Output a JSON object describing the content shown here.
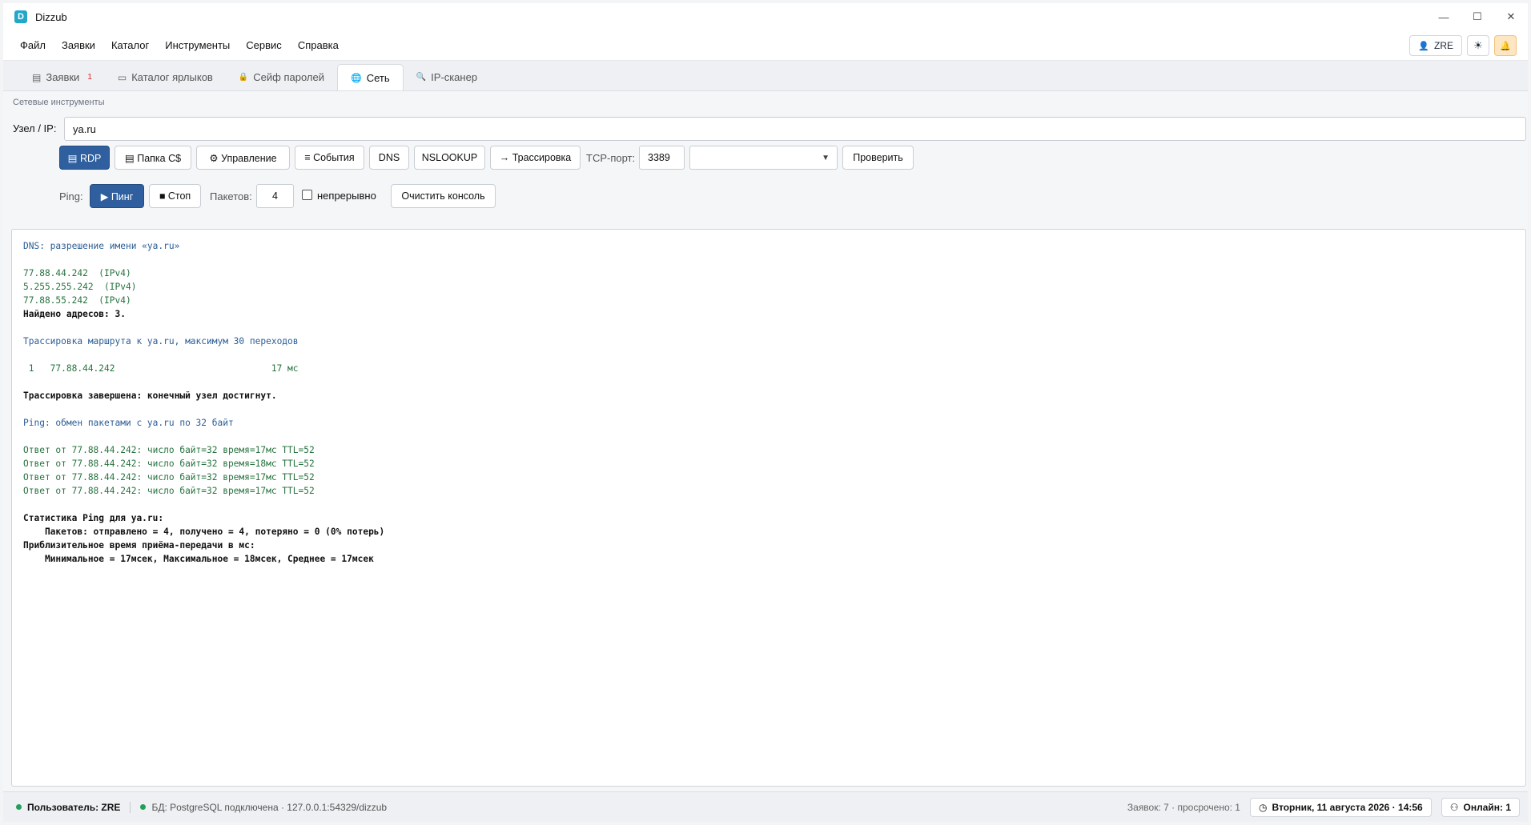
{
  "window": {
    "logo_letter": "D",
    "title": "Dizzub",
    "minimize": "—",
    "maximize": "☐",
    "close": "✕"
  },
  "menu": {
    "items": [
      "Файл",
      "Заявки",
      "Каталог",
      "Инструменты",
      "Сервис",
      "Справка"
    ],
    "user_label": "ZRE",
    "user_icon": "👤",
    "theme_icon": "☀",
    "bell_icon": "🔔"
  },
  "tabs": [
    {
      "label": "Заявки",
      "icon": "▤",
      "badge": "1"
    },
    {
      "label": "Каталог ярлыков",
      "icon": "▭",
      "badge": ""
    },
    {
      "label": "Сейф паролей",
      "icon": "🔒",
      "badge": ""
    },
    {
      "label": "Сеть",
      "icon": "🌐",
      "badge": ""
    },
    {
      "label": "IP-сканер",
      "icon": "🔍",
      "badge": ""
    }
  ],
  "tools": {
    "section_title": "Сетевые инструменты",
    "host_label": "Узел / IP:",
    "host_value": "ya.ru",
    "buttons": {
      "rdp": "▤ RDP",
      "share": "▤ Папка C$",
      "manage": "⚙ Управление",
      "events": "≡ События",
      "dns": "DNS",
      "nslookup": "NSLOOKUP",
      "trace": "→ Трассировка",
      "check": "Проверить"
    },
    "tcp_label": "TCP-порт:",
    "tcp_port": "3389",
    "tcp_service": "",
    "ping_label": "Ping:",
    "ping_button": "▶ Пинг",
    "stop_button": "■ Стоп",
    "packets_label": "Пакетов:",
    "packets_value": "4",
    "continuous_label": "непрерывно",
    "continuous_checked": false,
    "clear_button": "Очистить консоль"
  },
  "console": [
    {
      "text": "DNS: разрешение имени «ya.ru»",
      "style": "head"
    },
    {
      "text": "",
      "style": "plain"
    },
    {
      "text": "77.88.44.242  (IPv4)",
      "style": "ok"
    },
    {
      "text": "5.255.255.242  (IPv4)",
      "style": "ok"
    },
    {
      "text": "77.88.55.242  (IPv4)",
      "style": "ok"
    },
    {
      "text": "Найдено адресов: 3.",
      "style": "bold"
    },
    {
      "text": "",
      "style": "plain"
    },
    {
      "text": "Трассировка маршрута к ya.ru, максимум 30 переходов",
      "style": "head"
    },
    {
      "text": "",
      "style": "plain"
    },
    {
      "text": " 1   77.88.44.242                             17 мс",
      "style": "ok"
    },
    {
      "text": "",
      "style": "plain"
    },
    {
      "text": "Трассировка завершена: конечный узел достигнут.",
      "style": "bold"
    },
    {
      "text": "",
      "style": "plain"
    },
    {
      "text": "Ping: обмен пакетами с ya.ru по 32 байт",
      "style": "head"
    },
    {
      "text": "",
      "style": "plain"
    },
    {
      "text": "Ответ от 77.88.44.242: число байт=32 время=17мс TTL=52",
      "style": "ok"
    },
    {
      "text": "Ответ от 77.88.44.242: число байт=32 время=18мс TTL=52",
      "style": "ok"
    },
    {
      "text": "Ответ от 77.88.44.242: число байт=32 время=17мс TTL=52",
      "style": "ok"
    },
    {
      "text": "Ответ от 77.88.44.242: число байт=32 время=17мс TTL=52",
      "style": "ok"
    },
    {
      "text": "",
      "style": "plain"
    },
    {
      "text": "Статистика Ping для ya.ru:",
      "style": "bold"
    },
    {
      "text": "    Пакетов: отправлено = 4, получено = 4, потеряно = 0 (0% потерь)",
      "style": "bold"
    },
    {
      "text": "Приблизительное время приёма-передачи в мс:",
      "style": "bold"
    },
    {
      "text": "    Минимальное = 17мсек, Максимальное = 18мсек, Среднее = 17мсек",
      "style": "bold"
    }
  ],
  "status": {
    "user": "Пользователь: ZRE",
    "db": "БД: PostgreSQL подключена · 127.0.0.1:54329/dizzub",
    "requests": "Заявок: 7 · просрочено: 1",
    "clock_icon": "◷",
    "datetime": "Вторник, 11 августа 2026 · 14:56",
    "online_icon": "⚇",
    "online": "Онлайн: 1"
  },
  "colors": {
    "accent": "#2f5f9e",
    "console_head": "#2c5d97",
    "console_ok": "#27733f",
    "status_dot": "#22a05a",
    "badge": "#dc2626"
  }
}
